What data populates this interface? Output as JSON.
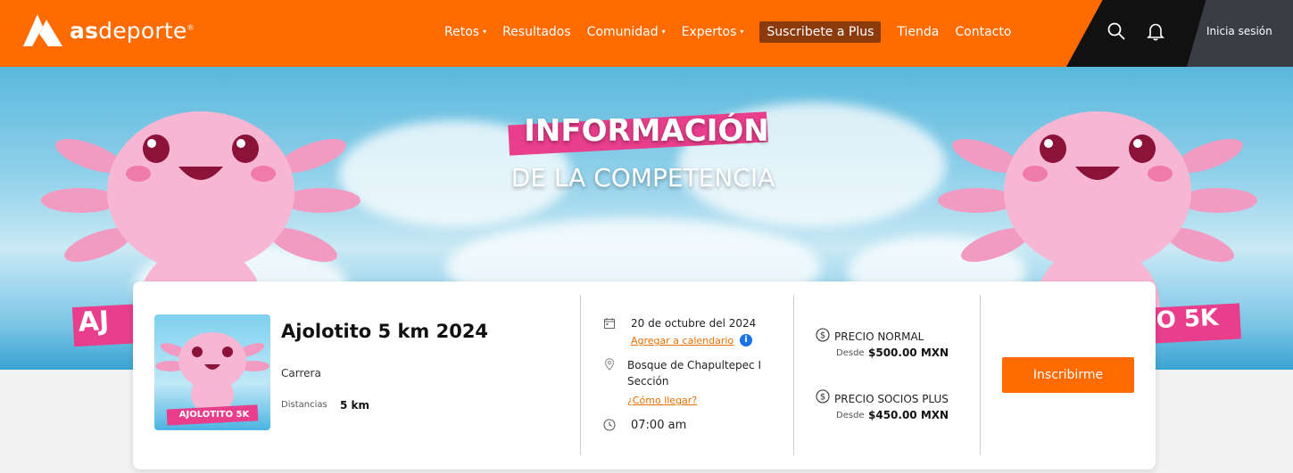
{
  "brand": {
    "name_bold": "as",
    "name_rest": "deporte",
    "reg": "®"
  },
  "nav": {
    "items": [
      {
        "label": "Retos",
        "dropdown": true
      },
      {
        "label": "Resultados",
        "dropdown": false
      },
      {
        "label": "Comunidad",
        "dropdown": true
      },
      {
        "label": "Expertos",
        "dropdown": true
      },
      {
        "label": "Suscribete a Plus",
        "dropdown": false,
        "highlight": true
      },
      {
        "label": "Tienda",
        "dropdown": false
      },
      {
        "label": "Contacto",
        "dropdown": false
      }
    ],
    "caret": "▾",
    "login_label": "Inicia sesión"
  },
  "hero": {
    "title": "INFORMACIÓN",
    "subtitle": "DE LA COMPETENCIA",
    "banner_left": "AJ",
    "banner_right": "O 5K"
  },
  "event": {
    "thumb_caption": "AJOLOTITO 5K",
    "title": "Ajolotito 5 km 2024",
    "type": "Carrera",
    "distances_label": "Distancias",
    "distances_value": "5 km",
    "date": "20 de octubre del 2024",
    "add_calendar": "Agregar a calendario",
    "info_glyph": "i",
    "location": "Bosque de Chapultepec I Sección",
    "location_line1": "Bosque de Chapultepec I",
    "location_line2": "Sección",
    "directions": "¿Cómo llegar?",
    "time": "07:00 am"
  },
  "pricing": {
    "normal_label": "PRECIO NORMAL",
    "normal_desde": "Desde",
    "normal_price": "$500.00 MXN",
    "plus_label": "PRECIO SOCIOS PLUS",
    "plus_desde": "Desde",
    "plus_price": "$450.00 MXN",
    "currency_glyph": "$"
  },
  "cta": {
    "label": "Inscribirme"
  },
  "colors": {
    "brand_orange": "#ff6b00",
    "plus_bg": "#8a3a0c",
    "link": "#e86f00",
    "info_blue": "#1a73e8",
    "axolotl_pink": "#f4a6c8"
  }
}
